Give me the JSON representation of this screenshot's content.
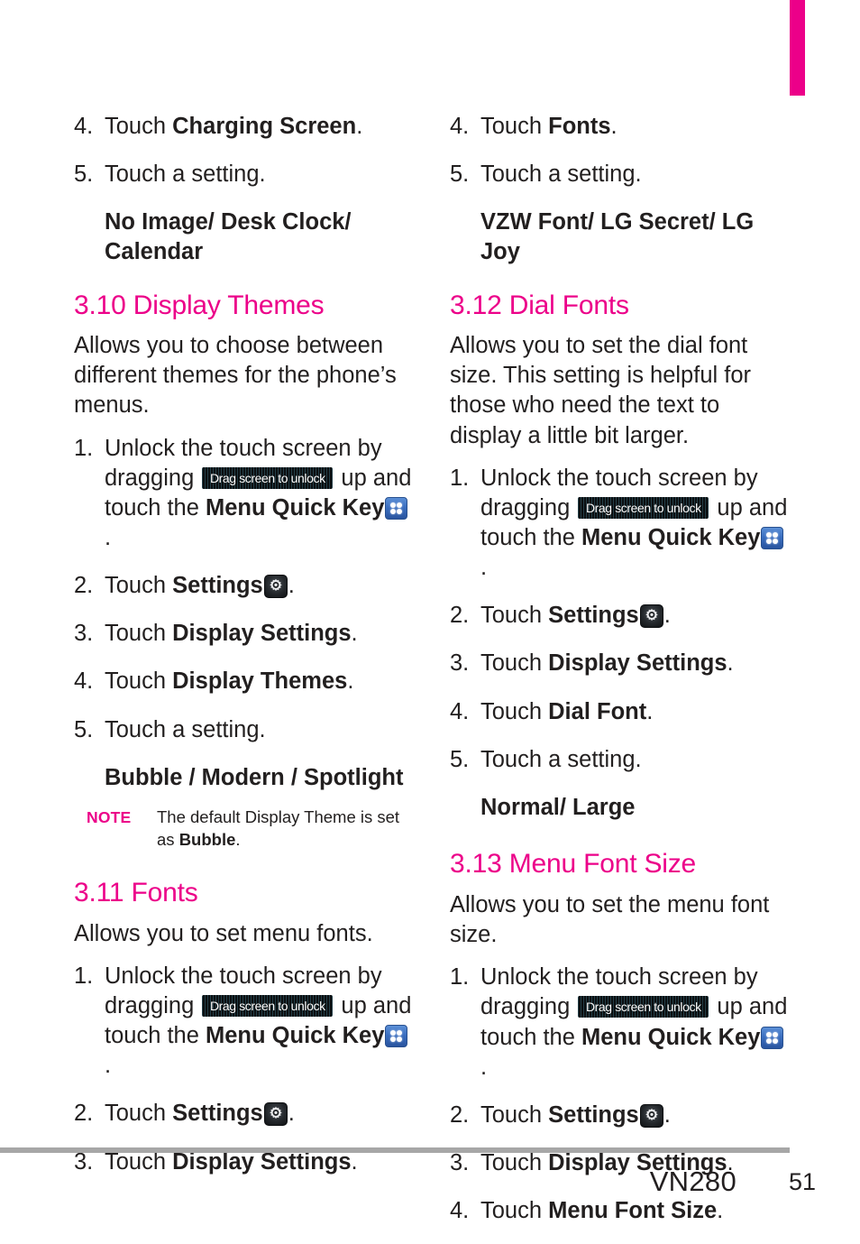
{
  "page": {
    "model": "VN280",
    "number": "51",
    "accent_color": "#ec0089",
    "text_color": "#221f1f"
  },
  "icons": {
    "unlock_label": "Drag screen to unlock",
    "unlock_name": "drag-screen-to-unlock-icon",
    "menu_key_name": "menu-quick-key-icon",
    "settings_gear_name": "settings-gear-icon"
  },
  "left_column": {
    "top_steps": [
      {
        "num": "4.",
        "pre": "Touch ",
        "bold": "Charging Screen",
        "post": "."
      },
      {
        "num": "5.",
        "pre": "Touch a setting.",
        "bold": "",
        "post": ""
      }
    ],
    "top_options": "No Image/ Desk Clock/ Calendar",
    "section_310": {
      "heading": "3.10 Display Themes",
      "intro": "Allows you to choose between different themes for the phone’s menus.",
      "steps": [
        {
          "num": "1.",
          "t1": "Unlock the touch screen by dragging ",
          "t2": " up and touch the ",
          "bold": "Menu Quick Key",
          "t3": "."
        },
        {
          "num": "2.",
          "pre": "Touch ",
          "bold": "Settings",
          "post": "."
        },
        {
          "num": "3.",
          "pre": "Touch ",
          "bold": "Display Settings",
          "post": "."
        },
        {
          "num": "4.",
          "pre": "Touch ",
          "bold": "Display Themes",
          "post": "."
        },
        {
          "num": "5.",
          "pre": "Touch a setting.",
          "bold": "",
          "post": ""
        }
      ],
      "options": "Bubble / Modern / Spotlight",
      "note_tag": "NOTE",
      "note_pre": "The default Display Theme is set as ",
      "note_bold": "Bubble",
      "note_post": "."
    },
    "section_311": {
      "heading": "3.11 Fonts",
      "intro": "Allows you to set menu fonts.",
      "steps": [
        {
          "num": "1.",
          "t1": "Unlock the touch screen by dragging ",
          "t2": " up and touch the ",
          "bold": "Menu Quick Key",
          "t3": "."
        },
        {
          "num": "2.",
          "pre": "Touch ",
          "bold": "Settings",
          "post": "."
        },
        {
          "num": "3.",
          "pre": "Touch ",
          "bold": "Display Settings",
          "post": "."
        }
      ]
    }
  },
  "right_column": {
    "top_steps": [
      {
        "num": "4.",
        "pre": "Touch ",
        "bold": "Fonts",
        "post": "."
      },
      {
        "num": "5.",
        "pre": "Touch a setting.",
        "bold": "",
        "post": ""
      }
    ],
    "top_options": "VZW Font/ LG Secret/ LG Joy",
    "section_312": {
      "heading": "3.12 Dial Fonts",
      "intro": "Allows you to set the dial font size. This setting is helpful for those who need the text to display a little bit larger.",
      "steps": [
        {
          "num": "1.",
          "t1": "Unlock the touch screen by dragging ",
          "t2": " up and touch the ",
          "bold": "Menu Quick Key",
          "t3": "."
        },
        {
          "num": "2.",
          "pre": "Touch ",
          "bold": "Settings",
          "post": "."
        },
        {
          "num": "3.",
          "pre": "Touch ",
          "bold": "Display Settings",
          "post": "."
        },
        {
          "num": "4.",
          "pre": "Touch ",
          "bold": "Dial Font",
          "post": "."
        },
        {
          "num": "5.",
          "pre": "Touch a setting.",
          "bold": "",
          "post": ""
        }
      ],
      "options": "Normal/ Large"
    },
    "section_313": {
      "heading": "3.13 Menu Font Size",
      "intro": "Allows you to set the menu font size.",
      "steps": [
        {
          "num": "1.",
          "t1": "Unlock the touch screen by dragging ",
          "t2": " up and touch the ",
          "bold": "Menu Quick Key",
          "t3": "."
        },
        {
          "num": "2.",
          "pre": "Touch ",
          "bold": "Settings",
          "post": "."
        },
        {
          "num": "3.",
          "pre": "Touch ",
          "bold": "Display Settings",
          "post": "."
        },
        {
          "num": "4.",
          "pre": "Touch ",
          "bold": "Menu Font Size",
          "post": "."
        }
      ]
    }
  }
}
